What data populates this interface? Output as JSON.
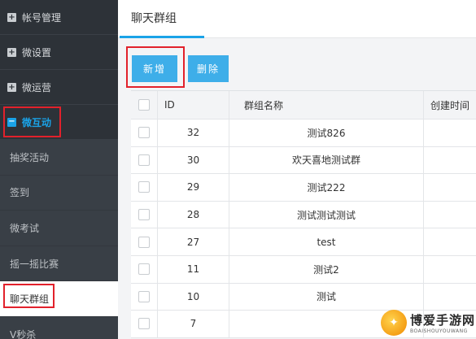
{
  "sidebar": {
    "groups": [
      {
        "label": "帐号管理"
      },
      {
        "label": "微设置"
      },
      {
        "label": "微运营"
      },
      {
        "label": "微互动"
      }
    ],
    "submenu": [
      {
        "label": "抽奖活动"
      },
      {
        "label": "签到"
      },
      {
        "label": "微考试"
      },
      {
        "label": "摇一摇比赛"
      },
      {
        "label": "聊天群组"
      },
      {
        "label": "V秒杀"
      }
    ]
  },
  "header": {
    "tab_title": "聊天群组"
  },
  "toolbar": {
    "add_label": "新增",
    "delete_label": "删除"
  },
  "table": {
    "columns": [
      "ID",
      "群组名称",
      "创建时间"
    ],
    "rows": [
      {
        "id": "32",
        "name": "测试826"
      },
      {
        "id": "30",
        "name": "欢天喜地测试群"
      },
      {
        "id": "29",
        "name": "测试222"
      },
      {
        "id": "28",
        "name": "测试测试测试"
      },
      {
        "id": "27",
        "name": "test"
      },
      {
        "id": "11",
        "name": "测试2"
      },
      {
        "id": "10",
        "name": "测试"
      },
      {
        "id": "7",
        "name": ""
      }
    ]
  },
  "watermark": {
    "title": "博爱手游网",
    "subtitle": "BOAISHOUYOUWANG"
  },
  "colors": {
    "accent": "#1aa3e8",
    "button": "#3eaee9",
    "sidebar_bg": "#2d3238",
    "highlight_box": "#e2212b"
  }
}
